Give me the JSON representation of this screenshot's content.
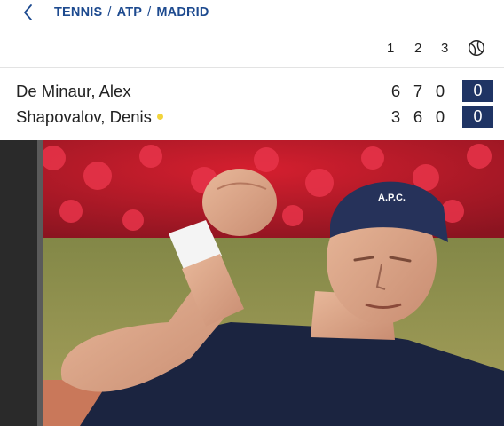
{
  "header": {
    "back_icon": "chevron-left-icon",
    "breadcrumb": [
      "TENNIS",
      "ATP",
      "MADRID"
    ],
    "separator": "/",
    "accent_color": "#1d4a8f"
  },
  "scoreboard": {
    "columns": [
      "1",
      "2",
      "3"
    ],
    "games_icon": "tennis-ball-icon",
    "players": [
      {
        "name": "De Minaur, Alex",
        "sets": [
          "6",
          "7",
          "0"
        ],
        "games": "0",
        "serving": false
      },
      {
        "name": "Shapovalov, Denis",
        "sets": [
          "3",
          "6",
          "0"
        ],
        "games": "0",
        "serving": true
      }
    ],
    "games_box_color": "#1f3464",
    "serve_indicator_color": "#f2d43c"
  },
  "video": {
    "content": "video-frame",
    "cap_logo": "A.P.C."
  }
}
